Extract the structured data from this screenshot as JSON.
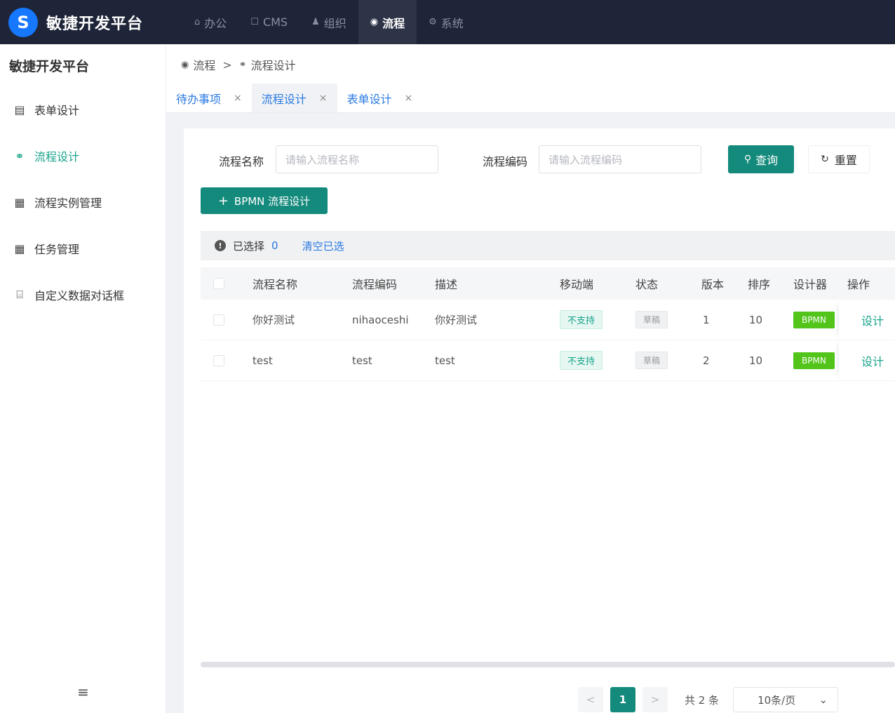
{
  "app": {
    "logo_glyph": "S",
    "title": "敏捷开发平台"
  },
  "nav": [
    {
      "icon": "home-icon",
      "glyph": "⌂",
      "label": "办公"
    },
    {
      "icon": "cms-icon",
      "glyph": "☐",
      "label": "CMS"
    },
    {
      "icon": "user-icon",
      "glyph": "♟",
      "label": "组织"
    },
    {
      "icon": "flow-icon",
      "glyph": "◉",
      "label": "流程",
      "active": true
    },
    {
      "icon": "settings-icon",
      "glyph": "⚙",
      "label": "系统"
    }
  ],
  "sidebar": {
    "title": "敏捷开发平台",
    "items": [
      {
        "icon": "form-icon",
        "glyph": "▤",
        "label": "表单设计"
      },
      {
        "icon": "flow-design-icon",
        "glyph": "⚭",
        "label": "流程设计",
        "active": true
      },
      {
        "icon": "grid-icon",
        "glyph": "▦",
        "label": "流程实例管理"
      },
      {
        "icon": "grid-icon",
        "glyph": "▦",
        "label": "任务管理"
      },
      {
        "icon": "dialog-icon",
        "glyph": "⌸",
        "label": "自定义数据对话框"
      }
    ],
    "collapse_glyph": "≡"
  },
  "breadcrumb": {
    "root": "流程",
    "current": "流程设计",
    "sep": ">"
  },
  "tabs": [
    {
      "label": "待办事项",
      "close": "×"
    },
    {
      "label": "流程设计",
      "close": "×",
      "active": true
    },
    {
      "label": "表单设计",
      "close": "×"
    }
  ],
  "search": {
    "name_label": "流程名称",
    "name_placeholder": "请输入流程名称",
    "code_label": "流程编码",
    "code_placeholder": "请输入流程编码",
    "query_label": "查询",
    "reset_label": "重置"
  },
  "create_button": {
    "plus": "+",
    "label": "BPMN 流程设计"
  },
  "selection": {
    "info": "!",
    "label": "已选择",
    "count": "0",
    "clear": "清空已选"
  },
  "table": {
    "columns": [
      "流程名称",
      "流程编码",
      "描述",
      "移动端",
      "状态",
      "版本",
      "排序",
      "设计器",
      "操作"
    ],
    "rows": [
      {
        "name": "你好测试",
        "code": "nihaoceshi",
        "desc": "你好测试",
        "mobile": "不支持",
        "status": "草稿",
        "version": "1",
        "sort": "10",
        "designer": "BPMN",
        "action": "设计"
      },
      {
        "name": "test",
        "code": "test",
        "desc": "test",
        "mobile": "不支持",
        "status": "草稿",
        "version": "2",
        "sort": "10",
        "designer": "BPMN",
        "action": "设计"
      }
    ]
  },
  "pagination": {
    "prev": "<",
    "page": "1",
    "next": ">",
    "total": "共 2 条",
    "page_size": "10条/页",
    "chevron": "⌄"
  },
  "colors": {
    "topbar": "#1f2538",
    "primary": "#148a7c",
    "accent_text": "#17a38a",
    "link_blue": "#2a7ae2",
    "bpmn_tag": "#52c41a"
  }
}
